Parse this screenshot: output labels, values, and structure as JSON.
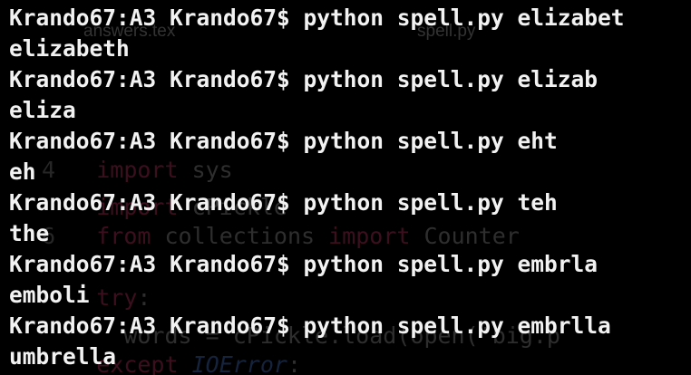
{
  "background_editor": {
    "tabs": [
      "answers.tex",
      "spell.py"
    ],
    "code": [
      {
        "num": "4",
        "kw": "import",
        "rest": " sys"
      },
      {
        "num": "",
        "kw": "import",
        "rest": " cPickle"
      },
      {
        "num": "6",
        "kw": "from",
        "rest": " collections ",
        "kw2": "import",
        "rest2": " Counter"
      },
      {
        "num": "",
        "kw": "try",
        "rest": ":"
      },
      {
        "num": "",
        "kw": "",
        "rest": "    words = cPickle.load(open('big.p"
      },
      {
        "num": "",
        "kw": "except",
        "rest": " ",
        "err": "IOError",
        "rest2": ":"
      }
    ]
  },
  "terminal": {
    "lines": [
      "Krando67:A3 Krando67$ python spell.py elizabet",
      "elizabeth",
      "Krando67:A3 Krando67$ python spell.py elizab",
      "eliza",
      "Krando67:A3 Krando67$ python spell.py eht",
      "eh",
      "Krando67:A3 Krando67$ python spell.py teh",
      "the",
      "Krando67:A3 Krando67$ python spell.py embrla",
      "emboli",
      "Krando67:A3 Krando67$ python spell.py embrlla",
      "umbrella"
    ]
  },
  "colors": {
    "background": "#000000",
    "text": "#f2f2f2"
  }
}
